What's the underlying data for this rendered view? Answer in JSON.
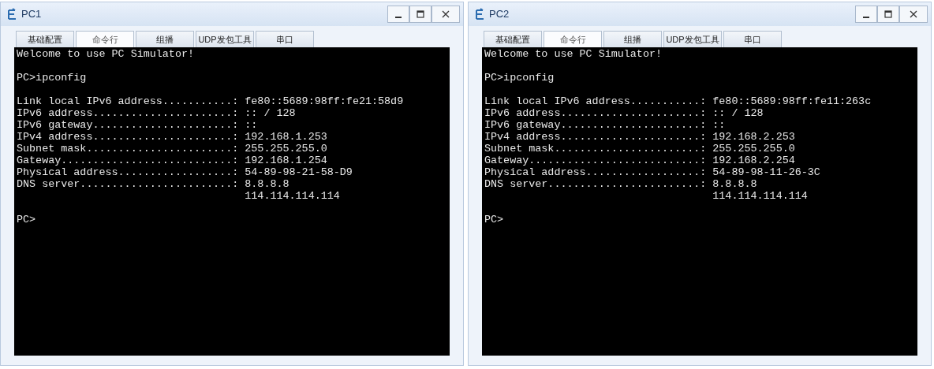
{
  "windows": [
    {
      "title": "PC1",
      "tabs": [
        {
          "label": "基础配置",
          "selected": false
        },
        {
          "label": "命令行",
          "selected": true
        },
        {
          "label": "组播",
          "selected": false
        },
        {
          "label": "UDP发包工具",
          "selected": false
        },
        {
          "label": "串口",
          "selected": false
        }
      ],
      "terminal": {
        "blocks": [
          [
            "Welcome to use PC Simulator!"
          ],
          [
            "PC>ipconfig"
          ],
          [
            "Link local IPv6 address...........: fe80::5689:98ff:fe21:58d9",
            "IPv6 address......................: :: / 128",
            "IPv6 gateway......................: ::",
            "IPv4 address......................: 192.168.1.253",
            "Subnet mask.......................: 255.255.255.0",
            "Gateway...........................: 192.168.1.254",
            "Physical address..................: 54-89-98-21-58-D9",
            "DNS server........................: 8.8.8.8",
            "                                    114.114.114.114"
          ],
          [
            "PC>"
          ]
        ]
      }
    },
    {
      "title": "PC2",
      "tabs": [
        {
          "label": "基础配置",
          "selected": false
        },
        {
          "label": "命令行",
          "selected": true
        },
        {
          "label": "组播",
          "selected": false
        },
        {
          "label": "UDP发包工具",
          "selected": false
        },
        {
          "label": "串口",
          "selected": false
        }
      ],
      "terminal": {
        "blocks": [
          [
            "Welcome to use PC Simulator!"
          ],
          [
            "PC>ipconfig"
          ],
          [
            "Link local IPv6 address...........: fe80::5689:98ff:fe11:263c",
            "IPv6 address......................: :: / 128",
            "IPv6 gateway......................: ::",
            "IPv4 address......................: 192.168.2.253",
            "Subnet mask.......................: 255.255.255.0",
            "Gateway...........................: 192.168.2.254",
            "Physical address..................: 54-89-98-11-26-3C",
            "DNS server........................: 8.8.8.8",
            "                                    114.114.114.114"
          ],
          [
            "PC>"
          ]
        ]
      }
    }
  ]
}
